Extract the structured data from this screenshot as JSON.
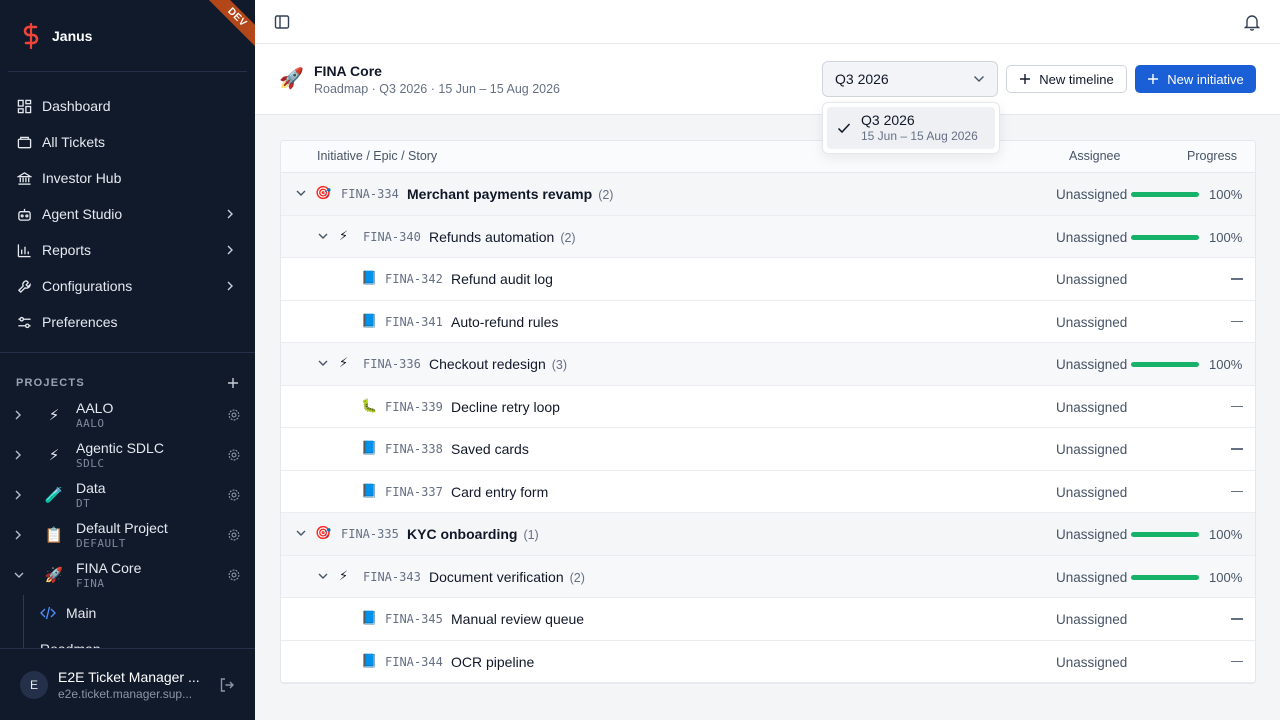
{
  "app": {
    "name": "Janus",
    "env_badge": "DEV"
  },
  "nav": [
    {
      "label": "Dashboard",
      "icon": "dashboard-icon",
      "has_submenu": false
    },
    {
      "label": "All Tickets",
      "icon": "tickets-icon",
      "has_submenu": false
    },
    {
      "label": "Investor Hub",
      "icon": "bank-icon",
      "has_submenu": false
    },
    {
      "label": "Agent Studio",
      "icon": "bot-icon",
      "has_submenu": true
    },
    {
      "label": "Reports",
      "icon": "bar-chart-icon",
      "has_submenu": true
    },
    {
      "label": "Configurations",
      "icon": "wrench-icon",
      "has_submenu": true
    },
    {
      "label": "Preferences",
      "icon": "sliders-icon",
      "has_submenu": false
    }
  ],
  "projects": {
    "heading": "PROJECTS",
    "items": [
      {
        "name": "AALO",
        "code": "AALO",
        "icon": "⚡",
        "expanded": false
      },
      {
        "name": "Agentic SDLC",
        "code": "SDLC",
        "icon": "⚡",
        "expanded": false
      },
      {
        "name": "Data",
        "code": "DT",
        "icon": "🧪",
        "expanded": false
      },
      {
        "name": "Default Project",
        "code": "DEFAULT",
        "icon": "📋",
        "expanded": false
      },
      {
        "name": "FINA Core",
        "code": "FINA",
        "icon": "🚀",
        "expanded": true
      }
    ],
    "sub_items": [
      {
        "label": "Main"
      },
      {
        "label": "Roadmap"
      }
    ]
  },
  "user": {
    "name": "E2E Ticket Manager ...",
    "email": "e2e.ticket.manager.sup...",
    "initial": "E"
  },
  "page": {
    "icon": "🚀",
    "title": "FINA Core",
    "subtitle": "Roadmap · Q3 2026 · 15 Jun – 15 Aug 2026",
    "period": "Q3 2026",
    "new_timeline": "New timeline",
    "new_initiative": "New initiative"
  },
  "dropdown": {
    "option_title": "Q3 2026",
    "option_range": "15 Jun – 15 Aug 2026"
  },
  "table": {
    "columns": [
      "Initiative / Epic / Story",
      "Assignee",
      "Progress"
    ],
    "rows": [
      {
        "level": 0,
        "icon": "🎯",
        "key": "FINA-334",
        "title": "Merchant payments revamp",
        "count": "(2)",
        "assignee": "Unassigned",
        "progress": 100,
        "progress_label": "100%"
      },
      {
        "level": 1,
        "icon": "⚡",
        "key": "FINA-340",
        "title": "Refunds automation",
        "count": "(2)",
        "assignee": "Unassigned",
        "progress": 100,
        "progress_label": "100%"
      },
      {
        "level": 2,
        "icon": "📘",
        "key": "FINA-342",
        "title": "Refund audit log",
        "count": "",
        "assignee": "Unassigned",
        "progress": null,
        "progress_label": ""
      },
      {
        "level": 2,
        "icon": "📘",
        "key": "FINA-341",
        "title": "Auto-refund rules",
        "count": "",
        "assignee": "Unassigned",
        "progress": null,
        "progress_label": ""
      },
      {
        "level": 1,
        "icon": "⚡",
        "key": "FINA-336",
        "title": "Checkout redesign",
        "count": "(3)",
        "assignee": "Unassigned",
        "progress": 100,
        "progress_label": "100%"
      },
      {
        "level": 2,
        "icon": "🐛",
        "key": "FINA-339",
        "title": "Decline retry loop",
        "count": "",
        "assignee": "Unassigned",
        "progress": null,
        "progress_label": ""
      },
      {
        "level": 2,
        "icon": "📘",
        "key": "FINA-338",
        "title": "Saved cards",
        "count": "",
        "assignee": "Unassigned",
        "progress": null,
        "progress_label": ""
      },
      {
        "level": 2,
        "icon": "📘",
        "key": "FINA-337",
        "title": "Card entry form",
        "count": "",
        "assignee": "Unassigned",
        "progress": null,
        "progress_label": ""
      },
      {
        "level": 0,
        "icon": "🎯",
        "key": "FINA-335",
        "title": "KYC onboarding",
        "count": "(1)",
        "assignee": "Unassigned",
        "progress": 100,
        "progress_label": "100%"
      },
      {
        "level": 1,
        "icon": "⚡",
        "key": "FINA-343",
        "title": "Document verification",
        "count": "(2)",
        "assignee": "Unassigned",
        "progress": 100,
        "progress_label": "100%"
      },
      {
        "level": 2,
        "icon": "📘",
        "key": "FINA-345",
        "title": "Manual review queue",
        "count": "",
        "assignee": "Unassigned",
        "progress": null,
        "progress_label": ""
      },
      {
        "level": 2,
        "icon": "📘",
        "key": "FINA-344",
        "title": "OCR pipeline",
        "count": "",
        "assignee": "Unassigned",
        "progress": null,
        "progress_label": ""
      }
    ]
  },
  "colors": {
    "sidebar_bg": "#101a2b",
    "primary": "#1b5fd6",
    "progress": "#17b26a",
    "brand": "#f04438"
  }
}
